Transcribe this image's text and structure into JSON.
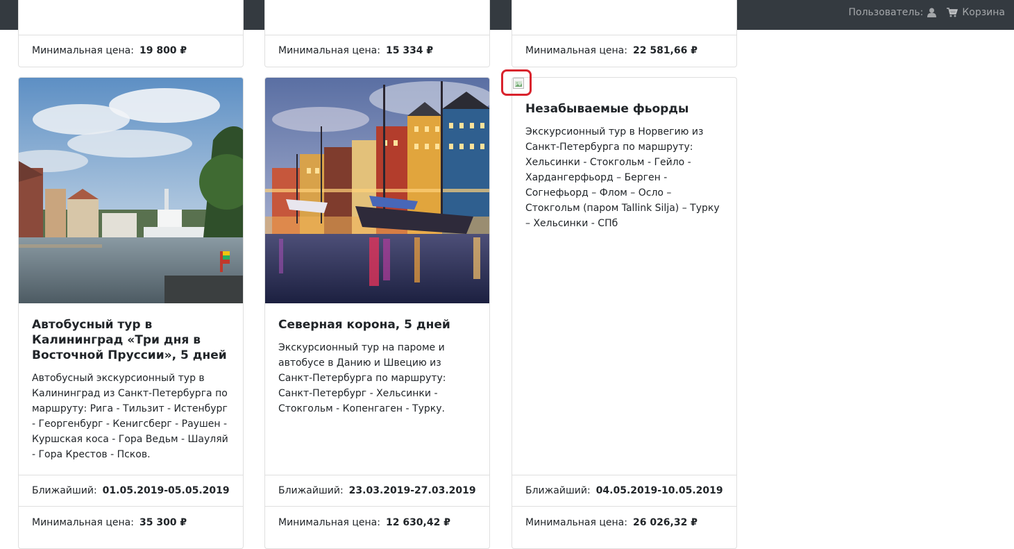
{
  "nav": {
    "user_label": "Пользователь:",
    "cart_label": "Корзина"
  },
  "prev_cards": [
    {
      "price_label": "Минимальная цена:",
      "price": "19 800 ₽"
    },
    {
      "price_label": "Минимальная цена:",
      "price": "15 334 ₽"
    },
    {
      "price_label": "Минимальная цена:",
      "price": "22 581,66 ₽"
    }
  ],
  "cards": [
    {
      "title": "Автобусный тур в Калининград «Три дня в Восточной Пруссии», 5 дней",
      "text": "Автобусный экскурсионный тур в Калининград из Санкт-Петербурга по маршруту: Рига - Тильзит - Истенбург - Георгенбург - Кенигсберг - Раушен - Куршская коса - Гора Ведьм - Шауляй - Гора Крестов - Псков.",
      "date_label": "Ближайший:",
      "date": "01.05.2019-05.05.2019",
      "price_label": "Минимальная цена:",
      "price": "35 300 ₽"
    },
    {
      "title": "Северная корона, 5 дней",
      "text": "Экскурсионный тур на пароме и автобусе в Данию и Швецию из Санкт-Петербурга по маршруту: Санкт-Петербург - Хельсинки - Стокгольм - Копенгаген - Турку.",
      "date_label": "Ближайший:",
      "date": "23.03.2019-27.03.2019",
      "price_label": "Минимальная цена:",
      "price": "12 630,42 ₽"
    },
    {
      "title": "Незабываемые фьорды",
      "text": "Экскурсионный тур в Норвегию из Санкт-Петербурга по маршруту: Хельсинки - Стокгольм - Гейло - Хардангерфьорд – Берген - Согнефьорд – Флом – Осло – Стокгольм (паром Tallink Silja) – Турку – Хельсинки - СПб",
      "date_label": "Ближайший:",
      "date": "04.05.2019-10.05.2019",
      "price_label": "Минимальная цена:",
      "price": "26 026,32 ₽"
    }
  ],
  "colors": {
    "navbar": "#343a40",
    "highlight": "#d9232d"
  },
  "icons": {
    "user": "user-icon",
    "cart": "cart-icon",
    "broken_image": "broken-image-icon"
  }
}
